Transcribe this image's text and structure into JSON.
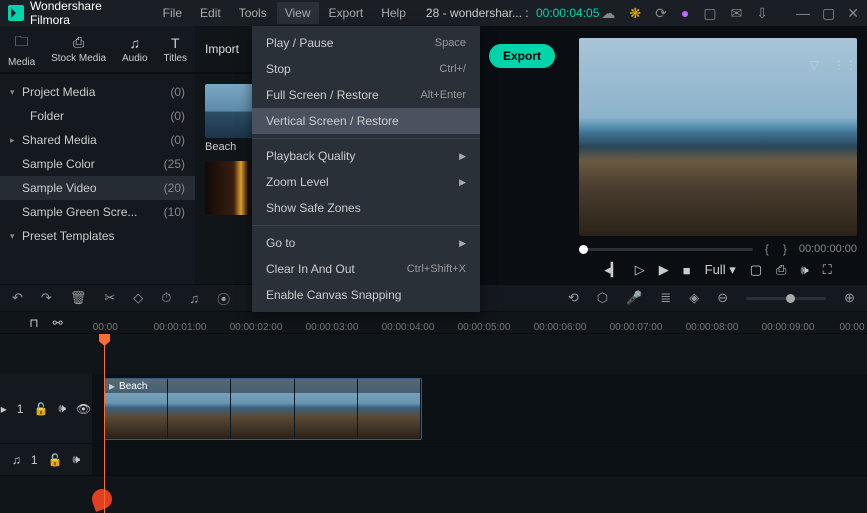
{
  "app": {
    "title": "Wondershare Filmora"
  },
  "menubar": [
    "File",
    "Edit",
    "Tools",
    "View",
    "Export",
    "Help"
  ],
  "document": {
    "name": "28 - wondershar...",
    "separator": ":",
    "time": "00:00:04:05"
  },
  "tabs": {
    "media": "Media",
    "stock": "Stock Media",
    "audio": "Audio",
    "titles": "Titles"
  },
  "tree": {
    "project_media": {
      "label": "Project Media",
      "count": "(0)"
    },
    "folder": {
      "label": "Folder",
      "count": "(0)"
    },
    "shared": {
      "label": "Shared Media",
      "count": "(0)"
    },
    "sample_color": {
      "label": "Sample Color",
      "count": "(25)"
    },
    "sample_video": {
      "label": "Sample Video",
      "count": "(20)"
    },
    "sample_green": {
      "label": "Sample Green Scre...",
      "count": "(10)"
    },
    "preset": {
      "label": "Preset Templates"
    }
  },
  "media_panel": {
    "import": "Import",
    "thumb1": "Beach"
  },
  "view_menu": [
    {
      "label": "Play / Pause",
      "shortcut": "Space"
    },
    {
      "label": "Stop",
      "shortcut": "Ctrl+/"
    },
    {
      "label": "Full Screen / Restore",
      "shortcut": "Alt+Enter"
    },
    {
      "label": "Vertical Screen / Restore",
      "hl": true
    },
    {
      "sep": true
    },
    {
      "label": "Playback Quality",
      "sub": true
    },
    {
      "label": "Zoom Level",
      "sub": true
    },
    {
      "label": "Show Safe Zones"
    },
    {
      "sep": true
    },
    {
      "label": "Go to",
      "sub": true
    },
    {
      "label": "Clear In And Out",
      "shortcut": "Ctrl+Shift+X",
      "disabled": true
    },
    {
      "label": "Enable Canvas Snapping"
    }
  ],
  "export_btn": "Export",
  "preview": {
    "time": "00:00:00:00",
    "full": "Full"
  },
  "ruler": [
    "|00:00",
    "00:00:01:00",
    "00:00:02:00",
    "00:00:03:00",
    "00:00:04:00",
    "00:00:05:00",
    "00:00:06:00",
    "00:00:07:00",
    "00:00:08:00",
    "00:00:09:00",
    "00:00"
  ],
  "clip": {
    "label": "Beach"
  },
  "track": {
    "v1": "1",
    "a1": "1"
  }
}
